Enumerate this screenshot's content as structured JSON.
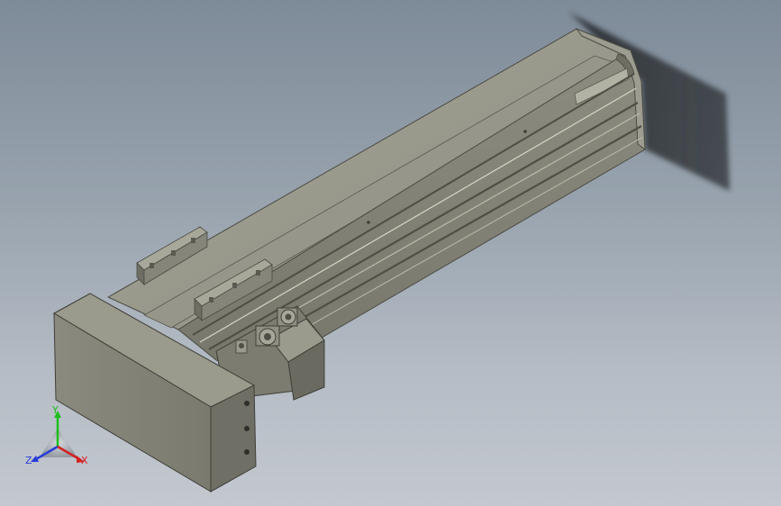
{
  "viewport": {
    "background_top": "#7e8b98",
    "background_bottom": "#c3c8cf"
  },
  "model": {
    "name": "linear-actuator-module",
    "body_color": "#87877a",
    "body_dark_color": "#5f5f55",
    "body_light_color": "#a8a89a",
    "shadow_color": "#2e3236"
  },
  "triad": {
    "y_label": "Y",
    "z_label": "Z",
    "x_label": "X",
    "y_color": "#1cbf1c",
    "z_color": "#2a3cd8",
    "x_color": "#d42020"
  }
}
